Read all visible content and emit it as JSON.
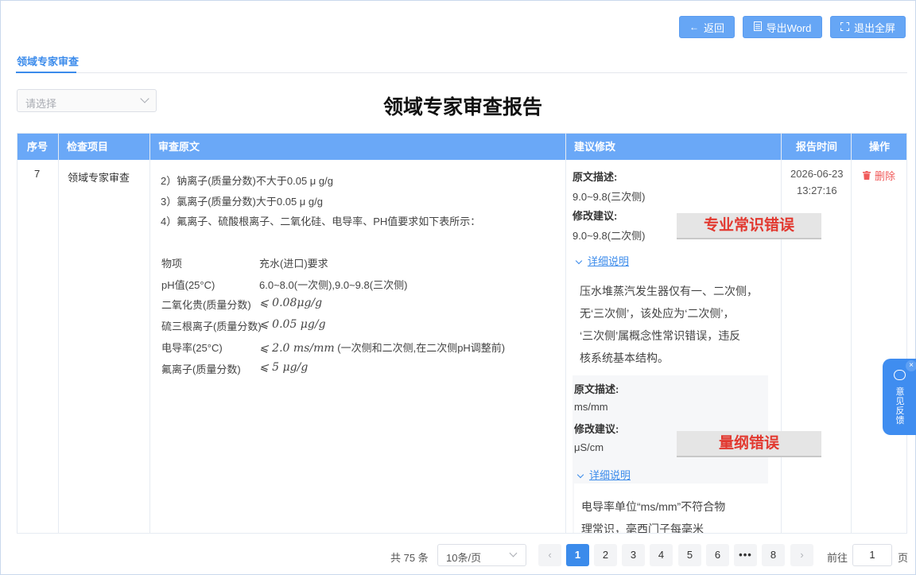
{
  "toolbar": {
    "back_label": "返回",
    "export_label": "导出Word",
    "exit_fullscreen_label": "退出全屏"
  },
  "tab": {
    "label": "领域专家审查"
  },
  "filter": {
    "placeholder": "请选择"
  },
  "report": {
    "title": "领域专家审查报告"
  },
  "table": {
    "headers": [
      "序号",
      "检查项目",
      "审查原文",
      "建议修改",
      "报告时间",
      "操作"
    ],
    "row": {
      "index": "7",
      "item": "领域专家审查",
      "original_lines": [
        "2）钠离子(质量分数)不大于0.05 μ g/g",
        "3）氯离子(质量分数)大于0.05 μ g/g",
        "4）氟离子、硫酸根离子、二氧化硅、电导率、PH值要求如下表所示："
      ],
      "spec_table": [
        {
          "k": "物项",
          "v": "充水(进口)要求"
        },
        {
          "k": "pH值(25°C)",
          "v": "6.0~8.0(一次侧),9.0~9.8(三次侧)"
        },
        {
          "k": "二氧化贵(质量分数)",
          "v": "⩽ 0.08μg/g"
        },
        {
          "k": "硫三根离子(质量分数)",
          "v": "⩽ 0.05 μg/g"
        },
        {
          "k": "电导率(25°C)",
          "v": "⩽ 2.0 ms/mm",
          "note": "(一次侧和二次侧,在二次侧pH调整前)"
        },
        {
          "k": "氟离子(质量分数)",
          "v": "⩽ 5 μg/g"
        }
      ],
      "suggestions": [
        {
          "orig_label": "原文描述:",
          "orig_value": "9.0~9.8(三次侧)",
          "fix_label": "修改建议:",
          "fix_value": "9.0~9.8(二次侧)",
          "detail_label": "详细说明",
          "explain": [
            "压水堆蒸汽发生器仅有一、二次侧，",
            "无‘三次侧’，该处应为‘二次侧’，",
            "‘三次侧’属概念性常识错误，违反",
            "核系统基本结构。"
          ],
          "tag": "专业常识错误"
        },
        {
          "orig_label": "原文描述:",
          "orig_value": "ms/mm",
          "fix_label": "修改建议:",
          "fix_value": "μS/cm",
          "detail_label": "详细说明",
          "explain": [
            "电导率单位“ms/mm”不符合物",
            "理常识，毫西门子每毫米"
          ],
          "tag": "量纲错误"
        }
      ],
      "time_date": "2026-06-23",
      "time_clock": "13:27:16",
      "delete_label": "删除"
    }
  },
  "pagination": {
    "total": "共 75 条",
    "page_size": "10条/页",
    "pages": [
      "1",
      "2",
      "3",
      "4",
      "5",
      "6",
      "•••",
      "8"
    ],
    "current": "1",
    "goto_label": "前往",
    "goto_value": "1",
    "goto_suffix": "页"
  },
  "feedback": {
    "label": "意见反馈",
    "close": "×"
  },
  "colors": {
    "accent": "#3b8beb",
    "header": "#6aa8f7",
    "danger": "#f05a5a",
    "tag_text": "#e2382f"
  },
  "icons": [
    "arrow-left-icon",
    "document-icon",
    "exit-fullscreen-icon",
    "chevron-down-icon",
    "trash-icon",
    "chat-bubble-icon"
  ]
}
